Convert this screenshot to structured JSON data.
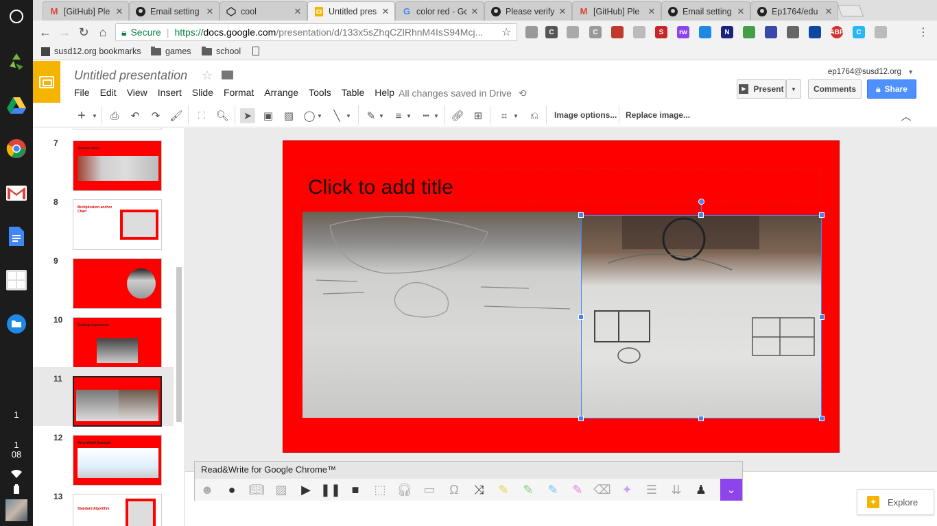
{
  "shelf": {
    "status_num": "1",
    "clock_hour": "1",
    "clock_min": "08"
  },
  "tabs": [
    {
      "title": "[GitHub] Ple",
      "icon": "gmail-icon"
    },
    {
      "title": "Email setting",
      "icon": "github-icon"
    },
    {
      "title": "cool",
      "icon": "codepen-icon"
    },
    {
      "title": "Untitled pres",
      "icon": "slides-icon",
      "active": true
    },
    {
      "title": "color red - Go",
      "icon": "google-icon"
    },
    {
      "title": "Please verify",
      "icon": "github-icon"
    },
    {
      "title": "[GitHub] Ple",
      "icon": "gmail-icon"
    },
    {
      "title": "Email setting",
      "icon": "github-icon"
    },
    {
      "title": "Ep1764/edu",
      "icon": "github-icon"
    }
  ],
  "omnibox": {
    "secure_label": "Secure",
    "scheme": "https://",
    "host": "docs.google.com",
    "path": "/presentation/d/133x5sZhqCZlRhnM4IsS94Mcj..."
  },
  "bookmarks": [
    "susd12.org bookmarks",
    "games",
    "school"
  ],
  "doc": {
    "title": "Untitled presentation",
    "menu": [
      "File",
      "Edit",
      "View",
      "Insert",
      "Slide",
      "Format",
      "Arrange",
      "Tools",
      "Table",
      "Help"
    ],
    "saved_status": "All changes saved in Drive",
    "user_email": "ep1764@susd12.org",
    "present_label": "Present",
    "comments_label": "Comments",
    "share_label": "Share"
  },
  "toolbar": {
    "image_options": "Image options...",
    "replace_image": "Replace image..."
  },
  "filmstrip": [
    {
      "num": "7",
      "caption": "Volume Ideas"
    },
    {
      "num": "8",
      "caption": "Multiplication anchor Chart"
    },
    {
      "num": "9",
      "caption": ""
    },
    {
      "num": "10",
      "caption": "Scaling expression"
    },
    {
      "num": "11",
      "caption": "",
      "current": true
    },
    {
      "num": "12",
      "caption": "Area Model Example"
    },
    {
      "num": "13",
      "caption": "Standard Algorithm"
    }
  ],
  "slide": {
    "title_placeholder": "Click to add title"
  },
  "readwrite": {
    "title": "Read&Write for Google Chrome™"
  },
  "explore_label": "Explore",
  "colors": {
    "slide_bg": "#ff0000",
    "slides_brand": "#f4b400",
    "selection": "#4285f4",
    "share": "#4d90fe",
    "readwrite_accent": "#8e44ec"
  }
}
